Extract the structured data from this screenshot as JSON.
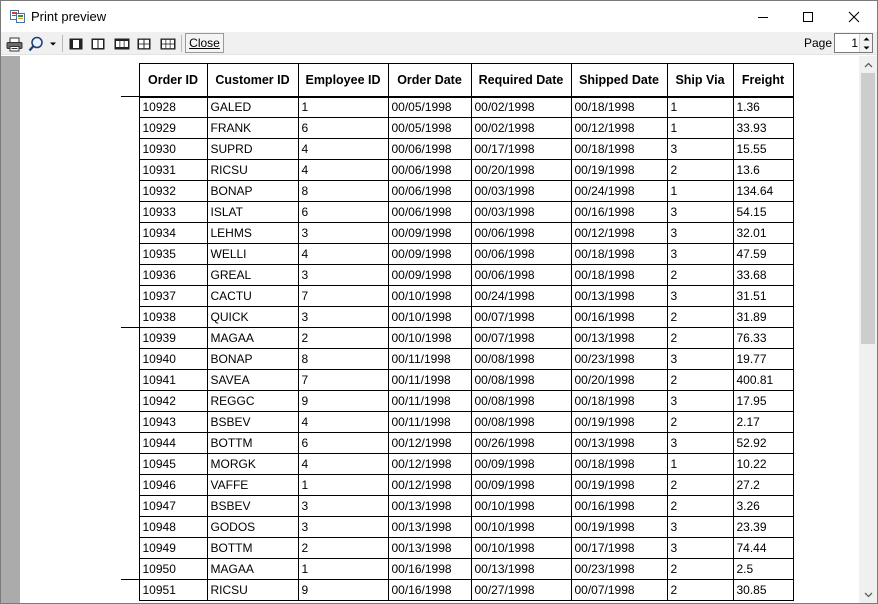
{
  "window": {
    "title": "Print preview"
  },
  "toolbar": {
    "print_icon": "printer-icon",
    "zoom_icon": "magnifier-icon",
    "one_page_icon": "one-page-icon",
    "two_pages_icon": "two-pages-icon",
    "three_pages_icon": "three-pages-icon",
    "four_pages_icon": "four-pages-icon",
    "six_pages_icon": "six-pages-icon",
    "close_label": "Close",
    "page_label": "Page",
    "page_value": "1"
  },
  "table": {
    "columns": [
      "Order ID",
      "Customer ID",
      "Employee ID",
      "Order Date",
      "Required Date",
      "Shipped Date",
      "Ship Via",
      "Freight"
    ],
    "rows": [
      [
        "10928",
        "GALED",
        "1",
        "00/05/1998",
        "00/02/1998",
        "00/18/1998",
        "1",
        "1.36"
      ],
      [
        "10929",
        "FRANK",
        "6",
        "00/05/1998",
        "00/02/1998",
        "00/12/1998",
        "1",
        "33.93"
      ],
      [
        "10930",
        "SUPRD",
        "4",
        "00/06/1998",
        "00/17/1998",
        "00/18/1998",
        "3",
        "15.55"
      ],
      [
        "10931",
        "RICSU",
        "4",
        "00/06/1998",
        "00/20/1998",
        "00/19/1998",
        "2",
        "13.6"
      ],
      [
        "10932",
        "BONAP",
        "8",
        "00/06/1998",
        "00/03/1998",
        "00/24/1998",
        "1",
        "134.64"
      ],
      [
        "10933",
        "ISLAT",
        "6",
        "00/06/1998",
        "00/03/1998",
        "00/16/1998",
        "3",
        "54.15"
      ],
      [
        "10934",
        "LEHMS",
        "3",
        "00/09/1998",
        "00/06/1998",
        "00/12/1998",
        "3",
        "32.01"
      ],
      [
        "10935",
        "WELLI",
        "4",
        "00/09/1998",
        "00/06/1998",
        "00/18/1998",
        "3",
        "47.59"
      ],
      [
        "10936",
        "GREAL",
        "3",
        "00/09/1998",
        "00/06/1998",
        "00/18/1998",
        "2",
        "33.68"
      ],
      [
        "10937",
        "CACTU",
        "7",
        "00/10/1998",
        "00/24/1998",
        "00/13/1998",
        "3",
        "31.51"
      ],
      [
        "10938",
        "QUICK",
        "3",
        "00/10/1998",
        "00/07/1998",
        "00/16/1998",
        "2",
        "31.89"
      ],
      [
        "10939",
        "MAGAA",
        "2",
        "00/10/1998",
        "00/07/1998",
        "00/13/1998",
        "2",
        "76.33"
      ],
      [
        "10940",
        "BONAP",
        "8",
        "00/11/1998",
        "00/08/1998",
        "00/23/1998",
        "3",
        "19.77"
      ],
      [
        "10941",
        "SAVEA",
        "7",
        "00/11/1998",
        "00/08/1998",
        "00/20/1998",
        "2",
        "400.81"
      ],
      [
        "10942",
        "REGGC",
        "9",
        "00/11/1998",
        "00/08/1998",
        "00/18/1998",
        "3",
        "17.95"
      ],
      [
        "10943",
        "BSBEV",
        "4",
        "00/11/1998",
        "00/08/1998",
        "00/19/1998",
        "2",
        "2.17"
      ],
      [
        "10944",
        "BOTTM",
        "6",
        "00/12/1998",
        "00/26/1998",
        "00/13/1998",
        "3",
        "52.92"
      ],
      [
        "10945",
        "MORGK",
        "4",
        "00/12/1998",
        "00/09/1998",
        "00/18/1998",
        "1",
        "10.22"
      ],
      [
        "10946",
        "VAFFE",
        "1",
        "00/12/1998",
        "00/09/1998",
        "00/19/1998",
        "2",
        "27.2"
      ],
      [
        "10947",
        "BSBEV",
        "3",
        "00/13/1998",
        "00/10/1998",
        "00/16/1998",
        "2",
        "3.26"
      ],
      [
        "10948",
        "GODOS",
        "3",
        "00/13/1998",
        "00/10/1998",
        "00/19/1998",
        "3",
        "23.39"
      ],
      [
        "10949",
        "BOTTM",
        "2",
        "00/13/1998",
        "00/10/1998",
        "00/17/1998",
        "3",
        "74.44"
      ],
      [
        "10950",
        "MAGAA",
        "1",
        "00/16/1998",
        "00/13/1998",
        "00/23/1998",
        "2",
        "2.5"
      ],
      [
        "10951",
        "RICSU",
        "9",
        "00/16/1998",
        "00/27/1998",
        "00/07/1998",
        "2",
        "30.85"
      ]
    ]
  }
}
